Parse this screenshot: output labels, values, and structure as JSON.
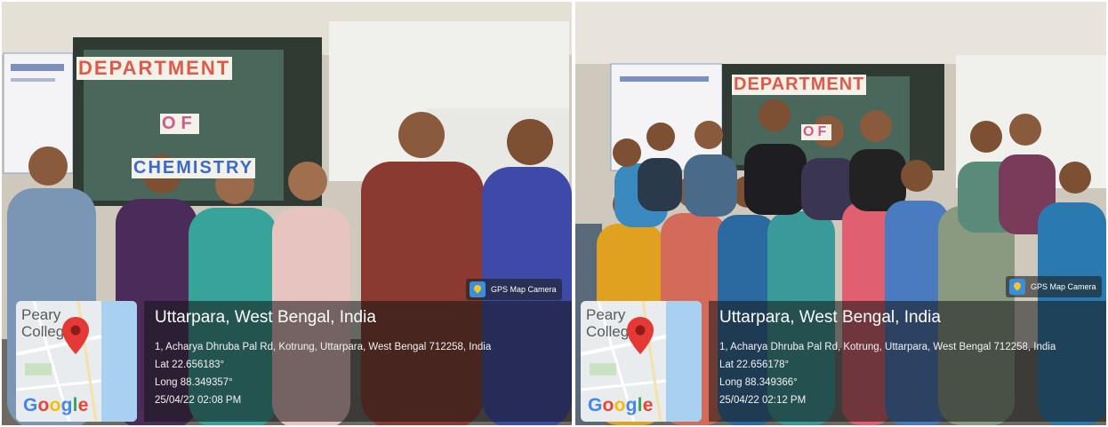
{
  "photos": [
    {
      "badge": "GPS Map Camera",
      "map_place": "Peary\nCollege",
      "map_logo": "Google",
      "title": "Uttarpara, West Bengal, India",
      "address": "1, Acharya Dhruba Pal Rd, Kotrung, Uttarpara, West Bengal 712258, India",
      "lat": "Lat 22.656183°",
      "long": "Long 88.349357°",
      "datetime": "25/04/22 02:08 PM",
      "board_text": [
        "DEPARTMENT",
        "OF",
        "CHEMISTRY"
      ]
    },
    {
      "badge": "GPS Map Camera",
      "map_place": "Peary\nCollege",
      "map_logo": "Google",
      "title": "Uttarpara, West Bengal, India",
      "address": "1, Acharya Dhruba Pal Rd, Kotrung, Uttarpara, West Bengal 712258, India",
      "lat": "Lat 22.656178°",
      "long": "Long 88.349366°",
      "datetime": "25/04/22 02:12 PM",
      "board_text": [
        "DEPARTMENT",
        "OF"
      ]
    }
  ],
  "colors": {
    "pin": "#e53935",
    "google_blue": "#4285F4",
    "google_red": "#EA4335",
    "google_yellow": "#FBBC05",
    "google_green": "#34A853"
  }
}
